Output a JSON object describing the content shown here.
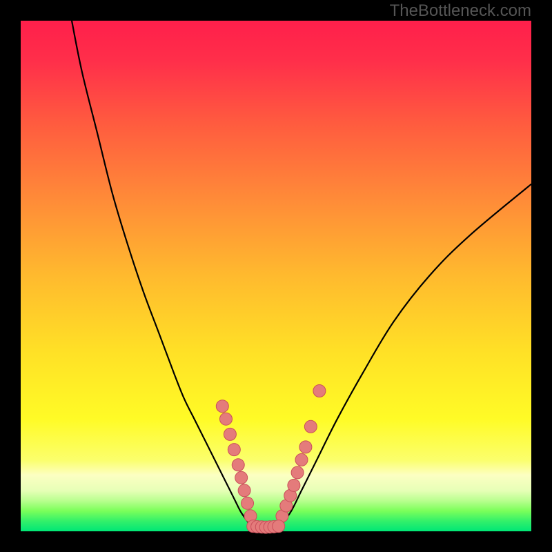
{
  "watermark": {
    "text": "TheBottleneck.com"
  },
  "colors": {
    "curve": "#000000",
    "dot_fill": "#e47b7b",
    "dot_stroke": "#c94f5a",
    "green_band_top": "#7bff5a",
    "green_band_bottom": "#00e676",
    "pale_band": "#fcfccf"
  },
  "chart_data": {
    "type": "line",
    "title": "",
    "xlabel": "",
    "ylabel": "",
    "xlim": [
      0,
      100
    ],
    "ylim": [
      0,
      100
    ],
    "series": [
      {
        "name": "left-branch",
        "x": [
          10,
          12,
          15,
          18,
          21,
          24,
          27,
          30,
          32,
          34,
          36,
          38,
          39.5,
          41,
          42,
          43,
          44,
          45
        ],
        "values": [
          100,
          90,
          78,
          66,
          56,
          47,
          39,
          31,
          26,
          22,
          18,
          14,
          11,
          8,
          6,
          4,
          2.5,
          1.2
        ]
      },
      {
        "name": "floor",
        "x": [
          45,
          46,
          47,
          48,
          49,
          50,
          51
        ],
        "values": [
          1.2,
          0.9,
          0.8,
          0.8,
          0.8,
          0.9,
          1.2
        ]
      },
      {
        "name": "right-branch",
        "x": [
          51,
          53,
          55,
          58,
          62,
          67,
          73,
          80,
          88,
          100
        ],
        "values": [
          1.2,
          4,
          8,
          14,
          22,
          31,
          41,
          50,
          58,
          68
        ]
      }
    ],
    "scatter": [
      {
        "name": "left-markers",
        "x": [
          39.5,
          40.2,
          41.0,
          41.8,
          42.6,
          43.2,
          43.8,
          44.4,
          45.0
        ],
        "values": [
          24.5,
          22.0,
          19.0,
          16.0,
          13.0,
          10.5,
          8.0,
          5.5,
          3.0
        ]
      },
      {
        "name": "right-markers",
        "x": [
          51.2,
          52.0,
          52.8,
          53.5,
          54.2,
          55.0,
          55.8,
          56.8,
          58.5
        ],
        "values": [
          3.0,
          5.0,
          7.0,
          9.0,
          11.5,
          14.0,
          16.5,
          20.5,
          27.5
        ]
      },
      {
        "name": "floor-markers",
        "x": [
          45.5,
          46.3,
          47.2,
          48.0,
          48.8,
          49.6,
          50.5
        ],
        "values": [
          1.0,
          0.9,
          0.85,
          0.8,
          0.85,
          0.9,
          1.0
        ]
      }
    ]
  }
}
